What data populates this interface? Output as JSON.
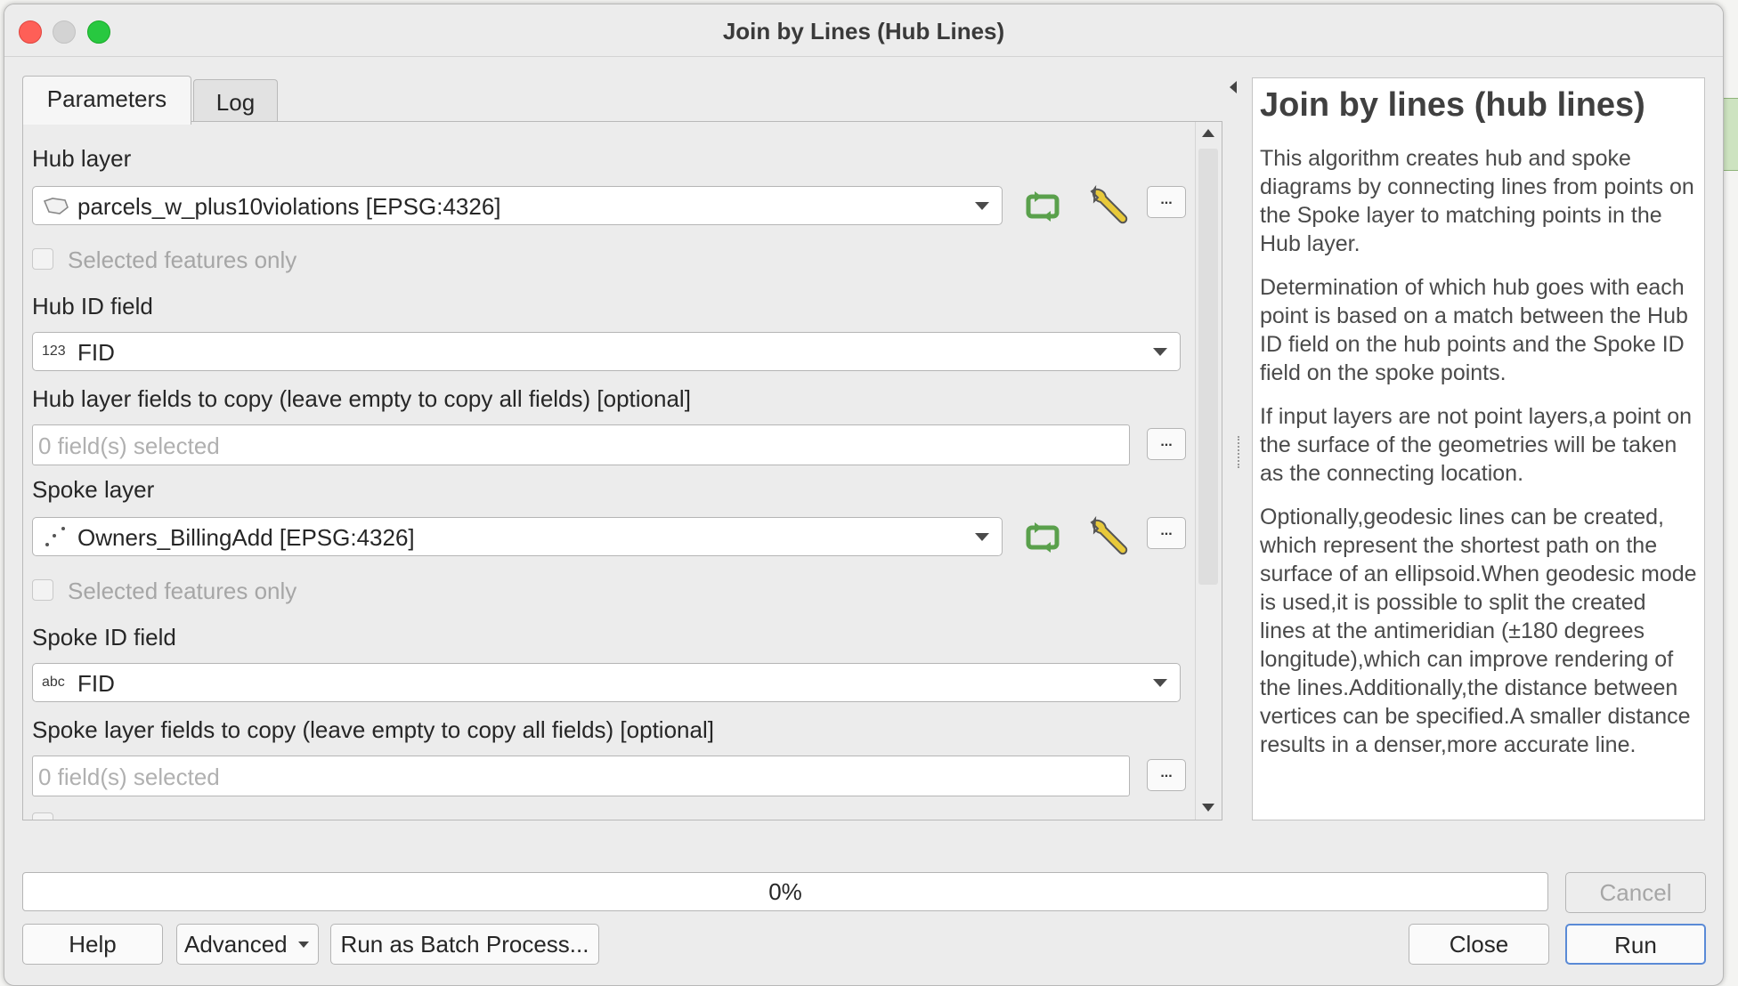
{
  "window": {
    "title": "Join by Lines (Hub Lines)"
  },
  "tabs": [
    {
      "label": "Parameters"
    },
    {
      "label": "Log"
    }
  ],
  "form": {
    "hub_layer": {
      "label": "Hub layer",
      "value": "parcels_w_plus10violations [EPSG:4326]",
      "selected_only": "Selected features only"
    },
    "hub_id_field": {
      "label": "Hub ID field",
      "type_tag": "123",
      "value": "FID"
    },
    "hub_fields": {
      "label": "Hub layer fields to copy (leave empty to copy all fields) [optional]",
      "placeholder": "0 field(s) selected"
    },
    "spoke_layer": {
      "label": "Spoke layer",
      "value": "Owners_BillingAdd [EPSG:4326]",
      "selected_only": "Selected features only"
    },
    "spoke_id_field": {
      "label": "Spoke ID field",
      "type_tag": "abc",
      "value": "FID"
    },
    "spoke_fields": {
      "label": "Spoke layer fields to copy (leave empty to copy all fields) [optional]",
      "placeholder": "0 field(s) selected"
    },
    "ellipsis": "..."
  },
  "help": {
    "title": "Join by lines (hub lines)",
    "paragraphs": [
      "This algorithm creates hub and spoke diagrams by connecting lines from points on the Spoke layer to matching points in the Hub layer.",
      "Determination of which hub goes with each point is based on a match between the Hub ID field on the hub points and the Spoke ID field on the spoke points.",
      "If input layers are not point layers,a point on the surface of the geometries will be taken as the connecting location.",
      "Optionally,geodesic lines can be created, which represent the shortest path on the surface of an ellipsoid.When geodesic mode is used,it is possible to split the created lines at the antimeridian (±180 degrees longitude),which can improve rendering of the lines.Additionally,the distance between vertices can be specified.A smaller distance results in a denser,more accurate line."
    ]
  },
  "progress": {
    "text": "0%",
    "value": 0
  },
  "buttons": {
    "cancel": "Cancel",
    "help": "Help",
    "advanced": "Advanced",
    "batch": "Run as Batch Process...",
    "close": "Close",
    "run": "Run"
  },
  "colors": {
    "refresh_icon": "#5aa04c",
    "accent": "#5a8ad6"
  }
}
